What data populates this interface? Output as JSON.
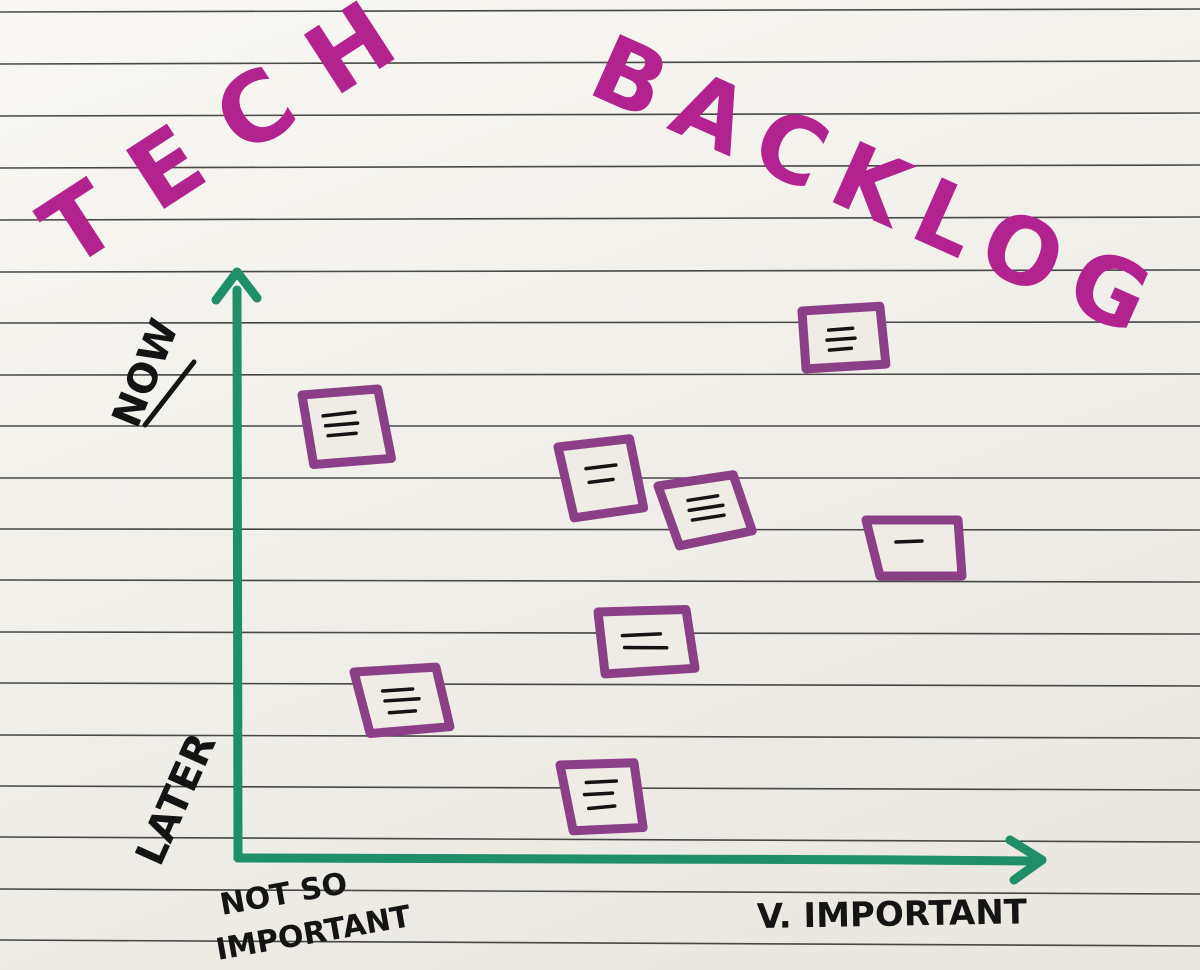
{
  "title": {
    "word1": "TECH",
    "word2": "BACKLOG"
  },
  "axes": {
    "y_top_label": "NOW",
    "y_bottom_label": "LATER",
    "x_left_label_line1": "NOT SO",
    "x_left_label_line2": "IMPORTANT",
    "x_right_label": "V. IMPORTANT"
  },
  "colors": {
    "title": "#b3238f",
    "axis": "#1f8f6a",
    "note": "#8a3f86",
    "note_fill": "#efece6",
    "ink": "#141414",
    "paper": "#f6f5f1",
    "rule": "#2b2b2b"
  },
  "notes": [
    {
      "id": "n1",
      "icon": "note-icon",
      "text_lines": 3
    },
    {
      "id": "n2",
      "icon": "note-icon",
      "text_lines": 2
    },
    {
      "id": "n3",
      "icon": "note-icon",
      "text_lines": 2
    },
    {
      "id": "n4",
      "icon": "note-icon",
      "text_lines": 3
    },
    {
      "id": "n5",
      "icon": "note-icon",
      "text_lines": 1
    },
    {
      "id": "n6",
      "icon": "note-icon",
      "text_lines": 2
    },
    {
      "id": "n7",
      "icon": "note-icon",
      "text_lines": 3
    },
    {
      "id": "n8",
      "icon": "note-icon",
      "text_lines": 3
    }
  ]
}
